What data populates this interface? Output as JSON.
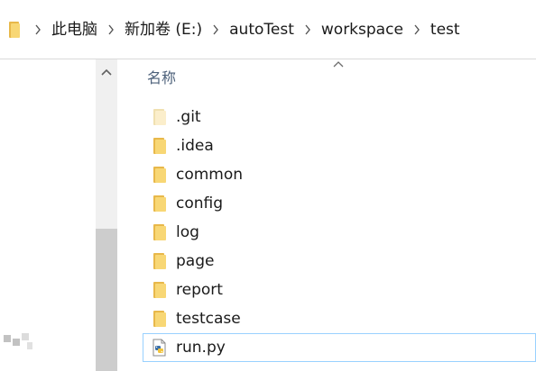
{
  "breadcrumb": {
    "items": [
      {
        "label": "此电脑"
      },
      {
        "label": "新加卷 (E:)"
      },
      {
        "label": "autoTest"
      },
      {
        "label": "workspace"
      },
      {
        "label": "test"
      }
    ]
  },
  "columns": {
    "name_header": "名称"
  },
  "files": [
    {
      "name": ".git",
      "type": "folder-faded"
    },
    {
      "name": ".idea",
      "type": "folder"
    },
    {
      "name": "common",
      "type": "folder"
    },
    {
      "name": "config",
      "type": "folder"
    },
    {
      "name": "log",
      "type": "folder"
    },
    {
      "name": "page",
      "type": "folder"
    },
    {
      "name": "report",
      "type": "folder"
    },
    {
      "name": "testcase",
      "type": "folder"
    },
    {
      "name": "run.py",
      "type": "python-file",
      "selected": true
    }
  ],
  "colors": {
    "folder_yellow": "#f8d775",
    "folder_dark": "#e8b84a",
    "selection_border": "#99d1ff",
    "header_text": "#4c607a"
  }
}
